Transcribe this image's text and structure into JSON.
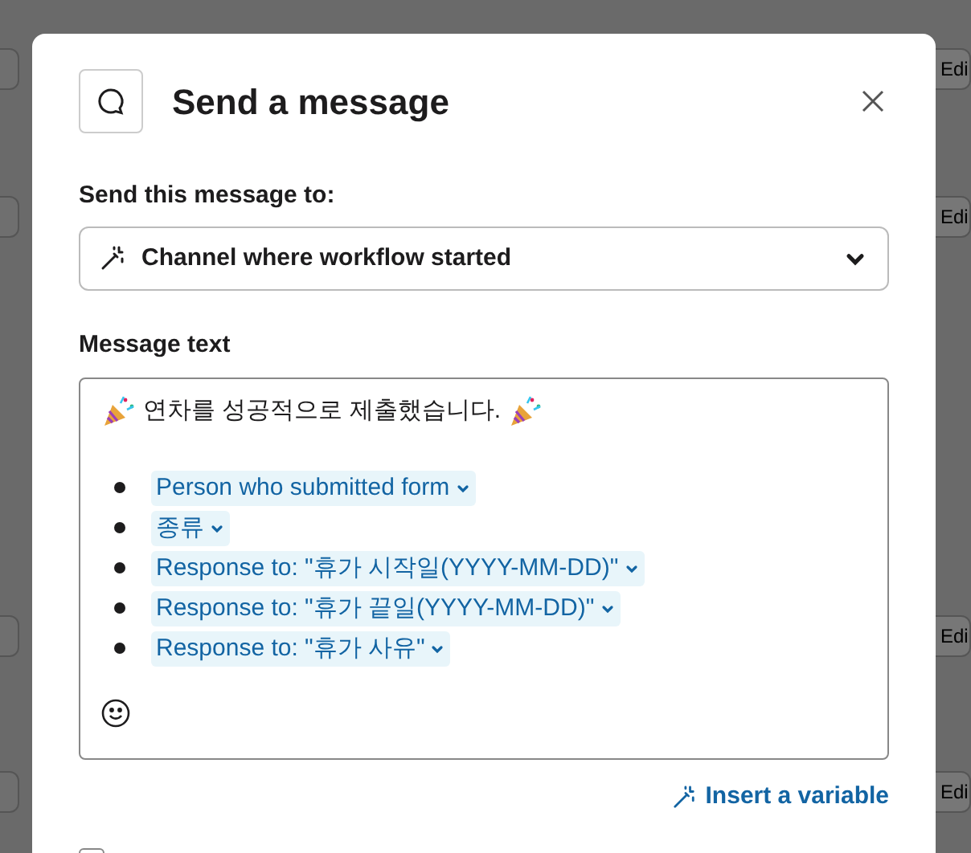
{
  "background": {
    "right_buttons": [
      "Edi",
      "Edi",
      "Edi",
      "Edi"
    ]
  },
  "dialog": {
    "title": "Send a message",
    "recipient": {
      "label": "Send this message to:",
      "value": "Channel where workflow started"
    },
    "message": {
      "label": "Message text",
      "intro": "연차를 성공적으로 제출했습니다.",
      "variables": [
        {
          "text": "Person who submitted form"
        },
        {
          "text": "종류"
        },
        {
          "text": "Response to: \"휴가 시작일(YYYY-MM-DD)\""
        },
        {
          "text": "Response to: \"휴가 끝일(YYYY-MM-DD)\""
        },
        {
          "text": "Response to: \"휴가 사유\""
        }
      ]
    },
    "insert_link": "Insert a variable",
    "checkbox": {
      "checked": false
    }
  }
}
